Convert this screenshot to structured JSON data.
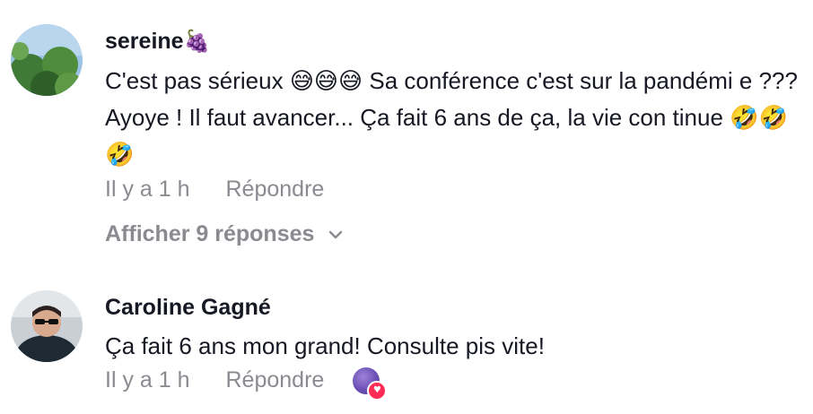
{
  "comments": [
    {
      "username": "sereine",
      "username_emoji": "🍇",
      "text": "C'est pas sérieux 😅😅😅 Sa conférence c'est sur la pandémi e ??? Ayoye ! Il faut avancer... Ça fait 6 ans de ça, la vie con tinue 🤣🤣🤣",
      "time": "Il y a 1 h",
      "reply_label": "Répondre",
      "view_replies": "Afficher 9 réponses"
    },
    {
      "username": "Caroline Gagné",
      "text": "Ça fait 6 ans mon grand! Consulte pis vite!",
      "time": "Il y a 1 h",
      "reply_label": "Répondre"
    }
  ],
  "icons": {
    "chevron": "chevron-down-icon",
    "liked_by_creator": "heart-icon"
  },
  "colors": {
    "text": "#161823",
    "muted": "#8a8b91",
    "heart": "#fe2c55"
  }
}
